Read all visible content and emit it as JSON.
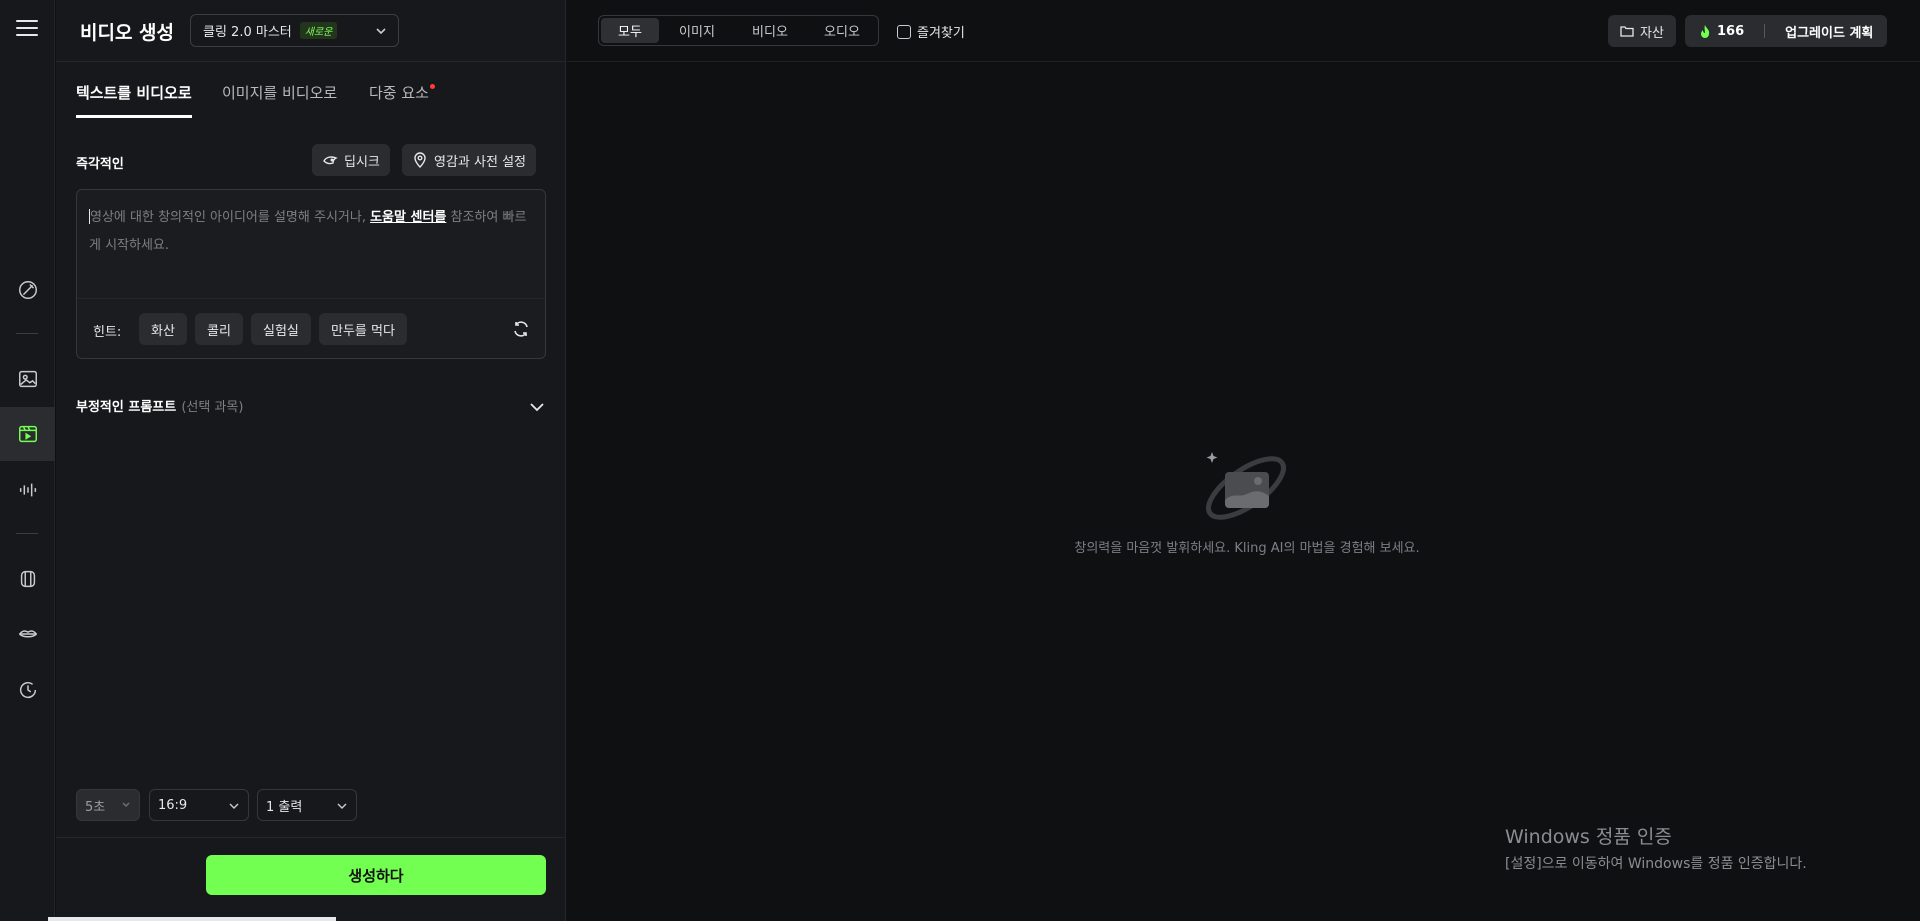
{
  "app": {
    "title": "비디오 생성"
  },
  "model": {
    "name": "클링 2.0 마스터",
    "badge": "새로운"
  },
  "tabs": [
    {
      "label": "텍스트를 비디오로",
      "active": true
    },
    {
      "label": "이미지를 비디오로",
      "active": false
    },
    {
      "label": "다중 요소",
      "active": false,
      "has_dot": true
    }
  ],
  "prompt_section": {
    "label": "즉각적인",
    "deepseek_label": "딥시크",
    "presets_label": "영감과 사전 설정",
    "placeholder_prefix": "영상에 대한 창의적인 아이디어를 설명해 주시거나, ",
    "help_link": "도움말 센터를",
    "placeholder_suffix": " 참조하여 빠르게 시작하세요.",
    "hint_label": "힌트:",
    "hints": [
      "화산",
      "콜리",
      "실험실",
      "만두를 먹다"
    ]
  },
  "negative_prompt": {
    "title": "부정적인 프롬프트",
    "optional": "(선택 과목)"
  },
  "settings": {
    "duration": "5초",
    "aspect_ratio": "16:9",
    "outputs": "1 출력"
  },
  "generate_label": "생성하다",
  "filter": {
    "items": [
      "모두",
      "이미지",
      "비디오",
      "오디오"
    ],
    "active": "모두",
    "favorites_label": "즐겨찾기"
  },
  "header": {
    "assets_label": "자산",
    "credits": "166",
    "upgrade_label": "업그레이드 계획"
  },
  "empty_state": {
    "text": "창의력을 마음껏 발휘하세요. Kling AI의 마법을 경험해 보세요."
  },
  "watermark": {
    "line1": "Windows 정품 인증",
    "line2": "[설정]으로 이동하여 Windows를 정품 인증합니다."
  },
  "colors": {
    "accent": "#73ff52",
    "background": "#0f1012",
    "panel": "#17181b"
  },
  "icons": {
    "rail": [
      "menu-icon",
      "wand-icon",
      "image-icon",
      "video-icon",
      "audio-icon",
      "avatar-icon",
      "lips-icon",
      "history-icon"
    ]
  }
}
